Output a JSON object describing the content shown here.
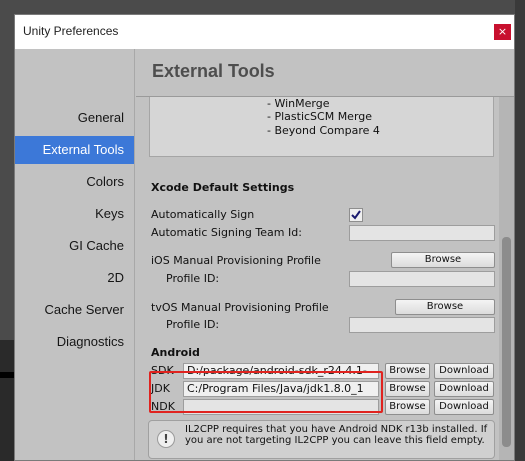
{
  "window": {
    "title": "Unity Preferences",
    "close_label": "×"
  },
  "sidebar": {
    "items": [
      {
        "label": "General"
      },
      {
        "label": "External Tools"
      },
      {
        "label": "Colors"
      },
      {
        "label": "Keys"
      },
      {
        "label": "GI Cache"
      },
      {
        "label": "2D"
      },
      {
        "label": "Cache Server"
      },
      {
        "label": "Diagnostics"
      }
    ],
    "active_index": 1
  },
  "main": {
    "title": "External Tools",
    "merge_tools": [
      "- WinMerge",
      "- PlasticSCM Merge",
      "- Beyond Compare 4"
    ],
    "xcode": {
      "heading": "Xcode Default Settings",
      "auto_sign_label": "Automatically Sign",
      "auto_sign_checked": true,
      "team_id_label": "Automatic Signing Team Id:",
      "team_id_value": "",
      "ios_profile_label": "iOS Manual Provisioning Profile",
      "ios_browse": "Browse",
      "ios_profile_id_label": "Profile ID:",
      "ios_profile_id_value": "",
      "tvos_profile_label": "tvOS Manual Provisioning Profile",
      "tvos_browse": "Browse",
      "tvos_profile_id_label": "Profile ID:",
      "tvos_profile_id_value": ""
    },
    "android": {
      "heading": "Android",
      "sdk_label": "SDK",
      "sdk_path": "D:/package/android-sdk_r24.4.1-",
      "jdk_label": "JDK",
      "jdk_path": "C:/Program Files/Java/jdk1.8.0_1",
      "ndk_label": "NDK",
      "ndk_path": "",
      "browse_label": "Browse",
      "download_label": "Download",
      "help_icon": "info-icon",
      "help_text": "IL2CPP requires that you have Android NDK r13b installed. If you are not targeting IL2CPP you can leave this field empty."
    }
  }
}
